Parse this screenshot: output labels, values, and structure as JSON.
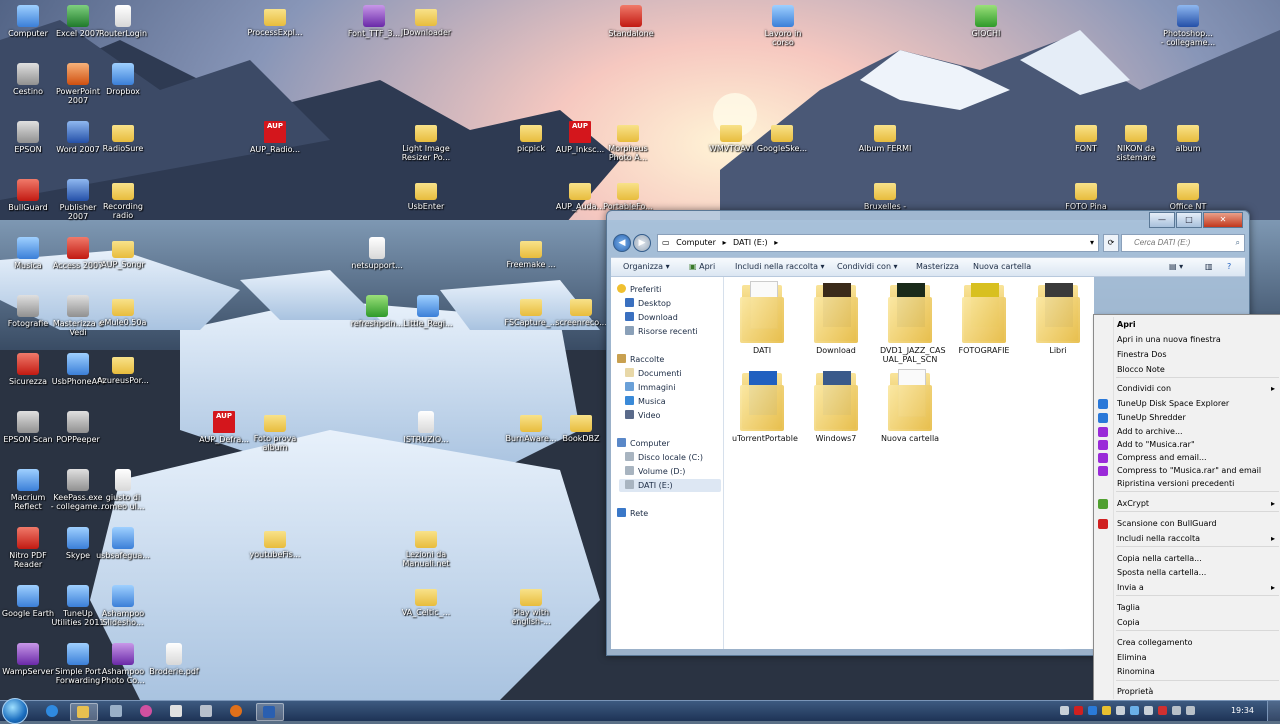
{
  "desktop_icons": [
    {
      "label": "Computer",
      "kind": "blue"
    },
    {
      "label": "Excel 2007",
      "kind": "excel"
    },
    {
      "label": "RouterLogin",
      "kind": "doc"
    },
    {
      "label": "ProcessExpl...",
      "kind": "folder"
    },
    {
      "label": "Font_TTF_3...",
      "kind": "purple"
    },
    {
      "label": "JDownloader",
      "kind": "folder"
    },
    {
      "label": "Standalone",
      "kind": "red"
    },
    {
      "label": "Lavoro in\ncorso",
      "kind": "blue"
    },
    {
      "label": "GIOCHI",
      "kind": "green"
    },
    {
      "label": "Photoshop...\n- collegame...",
      "kind": "word"
    },
    {
      "label": "Cestino",
      "kind": "grey"
    },
    {
      "label": "PowerPoint\n2007",
      "kind": "ppt"
    },
    {
      "label": "Dropbox",
      "kind": "blue"
    },
    {
      "label": "EPSON",
      "kind": "grey"
    },
    {
      "label": "Word 2007",
      "kind": "word"
    },
    {
      "label": "RadioSure",
      "kind": "folder"
    },
    {
      "label": "AUP_Radio...",
      "kind": "aup"
    },
    {
      "label": "Light Image\nResizer Po...",
      "kind": "folder"
    },
    {
      "label": "picpick",
      "kind": "folder"
    },
    {
      "label": "AUP_Inksc...",
      "kind": "aup"
    },
    {
      "label": "Morpheus\nPhoto A...",
      "kind": "folder"
    },
    {
      "label": "WMVTOAVI",
      "kind": "folder"
    },
    {
      "label": "GoogleSke...",
      "kind": "folder"
    },
    {
      "label": "Album FERMI",
      "kind": "folder"
    },
    {
      "label": "FONT",
      "kind": "folder"
    },
    {
      "label": "NIKON da\nsistemare",
      "kind": "folder"
    },
    {
      "label": "album",
      "kind": "folder"
    },
    {
      "label": "BullGuard",
      "kind": "red"
    },
    {
      "label": "Publisher\n2007",
      "kind": "word"
    },
    {
      "label": "Recording\nradio",
      "kind": "folder"
    },
    {
      "label": "UsbEnter",
      "kind": "folder"
    },
    {
      "label": "AUP_Auda...",
      "kind": "folder"
    },
    {
      "label": "PortableFo...",
      "kind": "folder"
    },
    {
      "label": "Bruxelles -",
      "kind": "folder"
    },
    {
      "label": "FOTO Pina",
      "kind": "folder"
    },
    {
      "label": "Office NT",
      "kind": "folder"
    },
    {
      "label": "Musica",
      "kind": "blue"
    },
    {
      "label": "Access 2007",
      "kind": "red"
    },
    {
      "label": "AUP_Songr",
      "kind": "folder"
    },
    {
      "label": "netsupport...",
      "kind": "doc"
    },
    {
      "label": "Freemake ...",
      "kind": "folder"
    },
    {
      "label": "Fotografie",
      "kind": "grey"
    },
    {
      "label": "Masterizza e\nVedi",
      "kind": "grey"
    },
    {
      "label": "eMule0.50a",
      "kind": "folder"
    },
    {
      "label": "refreshpcin...",
      "kind": "green"
    },
    {
      "label": "Little_Regi...",
      "kind": "blue"
    },
    {
      "label": "FSCapture_...",
      "kind": "folder"
    },
    {
      "label": "screenreco...",
      "kind": "folder"
    },
    {
      "label": "Sicurezza",
      "kind": "red"
    },
    {
      "label": "UsbPhoneAPI",
      "kind": "blue"
    },
    {
      "label": "AzureusPor...",
      "kind": "folder"
    },
    {
      "label": "EPSON Scan",
      "kind": "grey"
    },
    {
      "label": "POPPeeper",
      "kind": "grey"
    },
    {
      "label": "AUP_Defra...",
      "kind": "aup"
    },
    {
      "label": "Foto prova\nalbum",
      "kind": "folder"
    },
    {
      "label": "ISTRUZIO...",
      "kind": "doc"
    },
    {
      "label": "BurnAware...",
      "kind": "folder"
    },
    {
      "label": "BookDBZ",
      "kind": "folder"
    },
    {
      "label": "Macrium\nReflect",
      "kind": "blue"
    },
    {
      "label": "KeePass.exe\n- collegame...",
      "kind": "grey"
    },
    {
      "label": "giusto di\nromeo ul...",
      "kind": "doc"
    },
    {
      "label": "Nitro PDF\nReader",
      "kind": "red"
    },
    {
      "label": "Skype",
      "kind": "blue"
    },
    {
      "label": "usbsafegua...",
      "kind": "blue"
    },
    {
      "label": "youtubeFis...",
      "kind": "folder"
    },
    {
      "label": "Lezioni da\nManuali.net",
      "kind": "folder"
    },
    {
      "label": "Google Earth",
      "kind": "blue"
    },
    {
      "label": "TuneUp\nUtilities 2011",
      "kind": "blue"
    },
    {
      "label": "Ashampoo\nSlidesho...",
      "kind": "blue"
    },
    {
      "label": "VA_Celtic_...",
      "kind": "folder"
    },
    {
      "label": "Play with\nenglish-...",
      "kind": "folder"
    },
    {
      "label": "WampServer",
      "kind": "purple"
    },
    {
      "label": "Simple Port\nForwarding",
      "kind": "blue"
    },
    {
      "label": "Ashampoo\nPhoto Co...",
      "kind": "purple"
    },
    {
      "label": "Broderie.pdf",
      "kind": "doc"
    }
  ],
  "explorer": {
    "window_buttons": {
      "minimize": "—",
      "maximize": "□",
      "close": "✕"
    },
    "breadcrumb": [
      "Computer",
      "DATI (E:)"
    ],
    "search_placeholder": "Cerca DATI (E:)",
    "toolbar": [
      "Organizza",
      "Apri",
      "Includi nella raccolta",
      "Condividi con",
      "Masterizza",
      "Nuova cartella"
    ],
    "nav": {
      "favorites_header": "Preferiti",
      "favorites": [
        "Desktop",
        "Download",
        "Risorse recenti"
      ],
      "libraries_header": "Raccolte",
      "libraries": [
        "Documenti",
        "Immagini",
        "Musica",
        "Video"
      ],
      "computer_header": "Computer",
      "drives": [
        "Disco locale (C:)",
        "Volume (D:)",
        "DATI (E:)"
      ],
      "network": "Rete"
    },
    "items": [
      "DATI",
      "Download",
      "DVD1_JAZZ_CAS\nUAL_PAL_SCN",
      "FOTOGRAFIE",
      "Libri",
      "",
      "",
      "uTorrentPortable",
      "Windows7",
      "Nuova cartella"
    ]
  },
  "context_menu": [
    "Apri",
    "Apri in una nuova finestra",
    "Finestra Dos",
    "Blocco Note",
    "Condividi con",
    "TuneUp Disk Space Explorer",
    "TuneUp Shredder",
    "Add to archive...",
    "Add to \"Musica.rar\"",
    "Compress and email...",
    "Compress to \"Musica.rar\" and email",
    "Ripristina versioni precedenti",
    "AxCrypt",
    "Scansione con BullGuard",
    "Includi nella raccolta",
    "Copia nella cartella...",
    "Sposta nella cartella...",
    "Invia a",
    "Taglia",
    "Copia",
    "Crea collegamento",
    "Elimina",
    "Rinomina",
    "Proprietà"
  ],
  "taskbar": {
    "clock": "19:34"
  },
  "colors": {
    "folder": "#e8bc3d",
    "taskbar": "#1e3356",
    "selection": "#dde7f3",
    "menu": "#f1f1f1"
  }
}
